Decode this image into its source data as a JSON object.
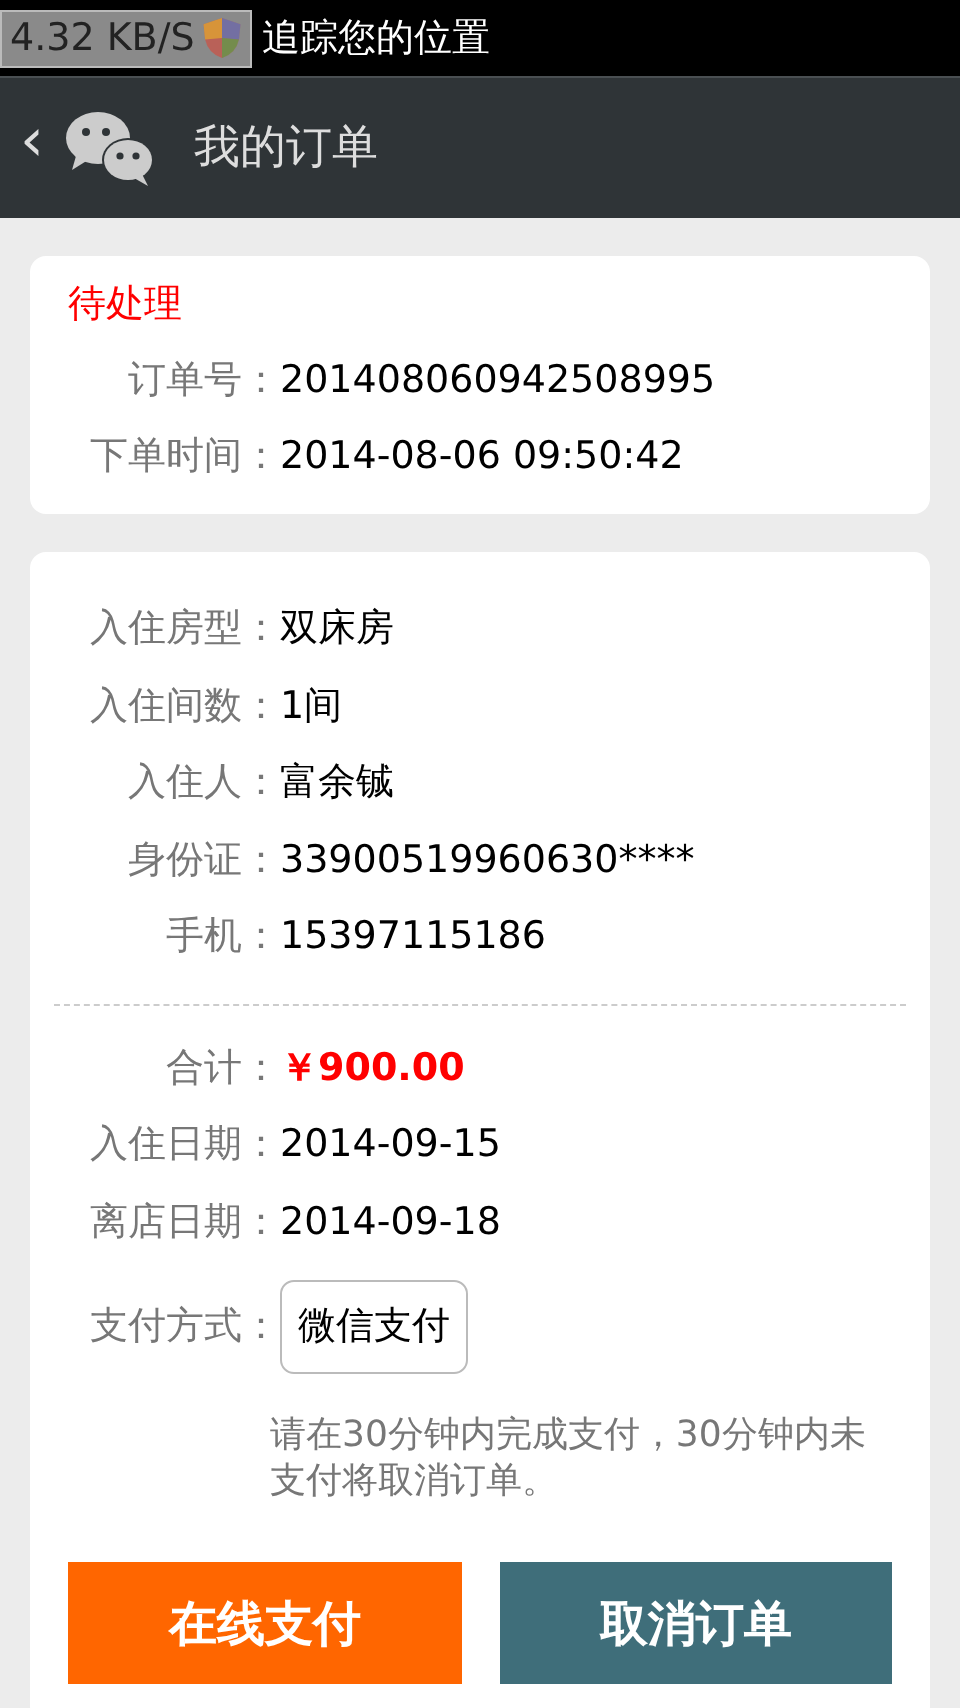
{
  "status_bar": {
    "speed": "4.32 KB/S",
    "ticker": "追踪您的位置"
  },
  "header": {
    "back": "‹",
    "title": "我的订单"
  },
  "order": {
    "status": "待处理",
    "fields": [
      {
        "label": "订单号：",
        "value": "201408060942508995"
      },
      {
        "label": "下单时间：",
        "value": "2014-08-06 09:50:42"
      }
    ]
  },
  "booking": {
    "fields": [
      {
        "label": "入住房型：",
        "value": "双床房"
      },
      {
        "label": "入住间数：",
        "value": "1间"
      },
      {
        "label": "入住人：",
        "value": "富余铖"
      },
      {
        "label": "身份证：",
        "value": "33900519960630****"
      },
      {
        "label": "手机：",
        "value": "15397115186"
      }
    ],
    "summary": [
      {
        "label": "合计：",
        "value": "￥900.00",
        "kind": "price"
      },
      {
        "label": "入住日期：",
        "value": "2014-09-15",
        "kind": "plain"
      },
      {
        "label": "离店日期：",
        "value": "2014-09-18",
        "kind": "plain"
      }
    ],
    "payment": {
      "label": "支付方式：",
      "option": "微信支付"
    },
    "note": "请在30分钟内完成支付，30分钟内未支付将取消订单。",
    "buttons": [
      {
        "label": "在线支付",
        "kind": "primary"
      },
      {
        "label": "取消订单",
        "kind": "secondary"
      }
    ]
  }
}
